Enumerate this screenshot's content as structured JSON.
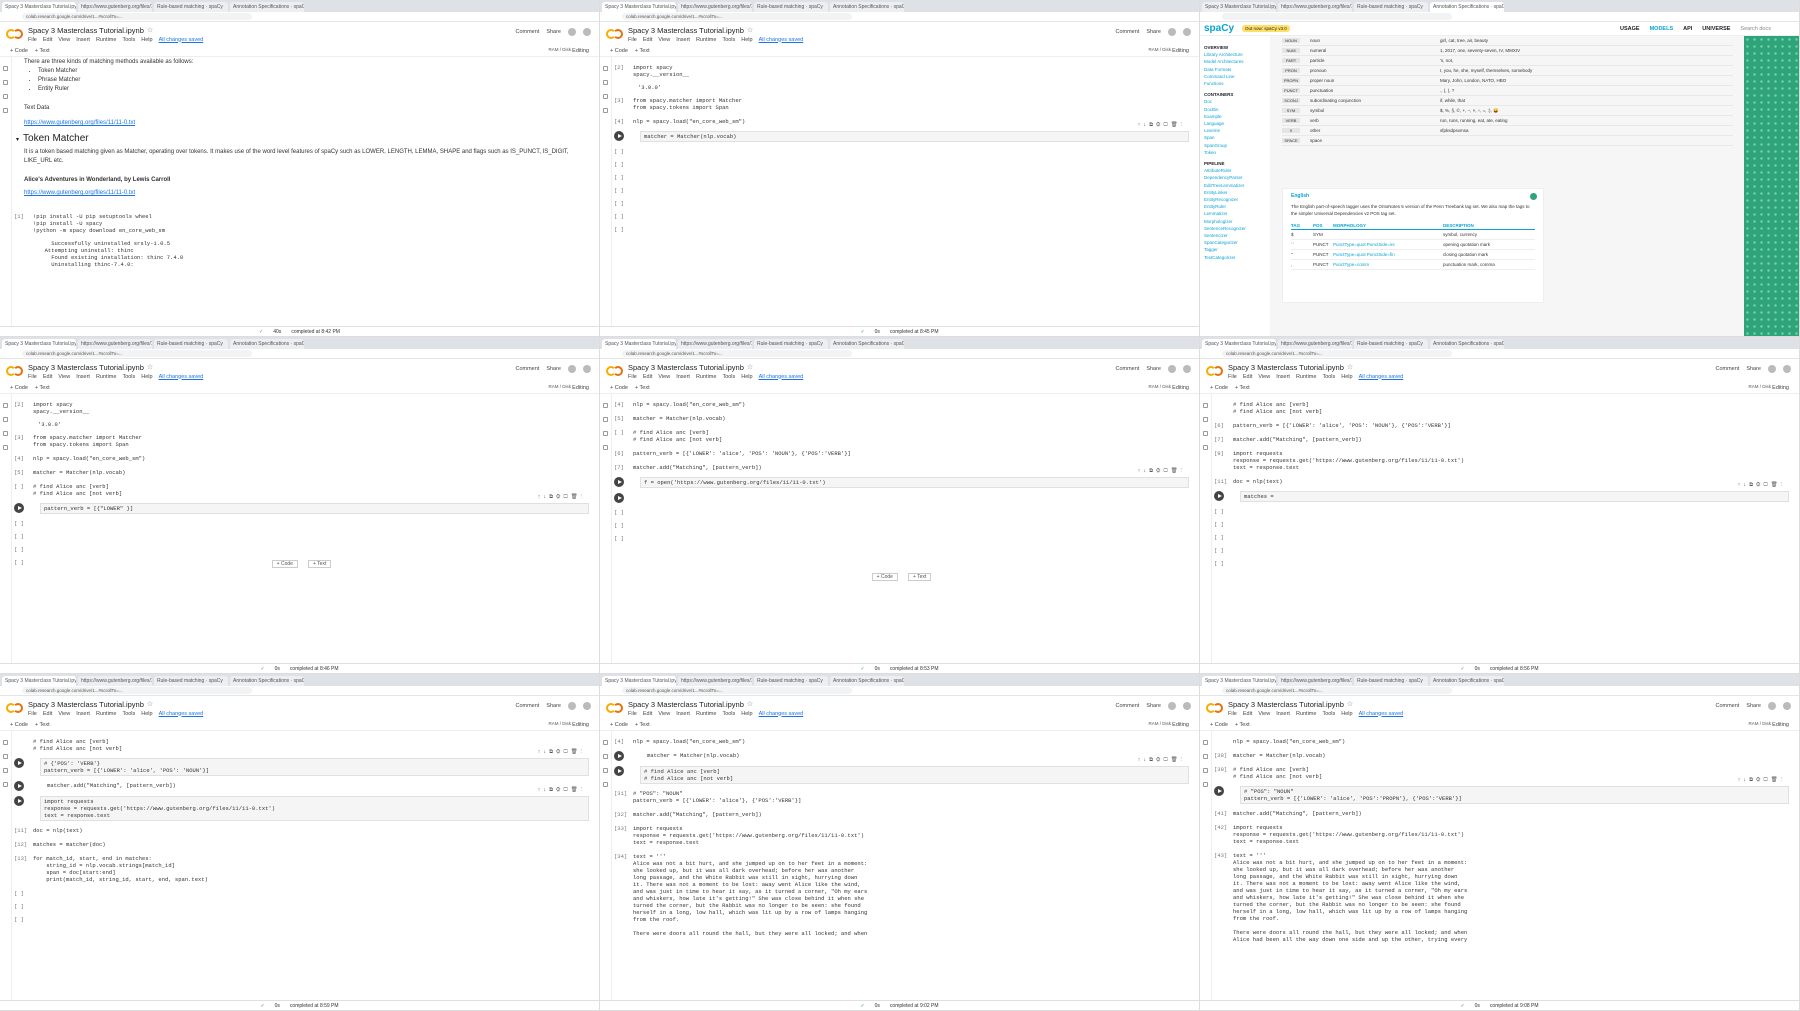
{
  "common": {
    "tabs": [
      "Spacy 3 Masterclass Tutorial.ipynb",
      "https://www.gutenberg.org/files/11",
      "Rule-based matching · spaCy",
      "Annotation Specifications · spaCy"
    ],
    "url": "colab.research.google.com/drive/1...#scrollTo=...",
    "notebook_title": "Spacy 3 Masterclass Tutorial.ipynb",
    "menu": [
      "File",
      "Edit",
      "View",
      "Insert",
      "Runtime",
      "Tools",
      "Help"
    ],
    "saved": "All changes saved",
    "comment": "Comment",
    "share": "Share",
    "add_code": "+ Code",
    "add_text": "+ Text",
    "ram": "RAM",
    "disk": "Disk",
    "editing": "Editing"
  },
  "panels": [
    {
      "status": {
        "time": "40s",
        "completed": "completed at 8:42 PM"
      },
      "intro": "There are three kinds of matching methods available as follows:",
      "methods": [
        "Token Matcher",
        "Phrase Matcher",
        "Entity Ruler"
      ],
      "text_data_label": "Text Data",
      "link1": "https://www.gutenberg.org/files/11/11-0.txt",
      "heading": "Token Matcher",
      "para": "It is a token based matching given as Matcher, operating over tokens. It makes use of the word level features of spaCy such as LOWER, LENGTH, LEMMA, SHAPE and flags such as IS_PUNCT, IS_DIGIT, LIKE_URL etc.",
      "book": "Alice's Adventures in Wonderland, by Lewis Carroll",
      "link2": "https://www.gutenberg.org/files/11/11-0.txt",
      "cell_idx": "[1]",
      "cell_code": "!pip install -U pip setuptools wheel\n!pip install -U spacy\n!python -m spacy download en_core_web_sm",
      "cell_out": "    Successfully uninstalled srsly-1.0.5\n  Attempting uninstall: thinc\n    Found existing installation: thinc 7.4.0\n    Uninstalling thinc-7.4.0:"
    },
    {
      "status": {
        "time": "0s",
        "completed": "completed at 8:45 PM"
      },
      "cells": [
        {
          "idx": "[2]",
          "code": "import spacy\nspacy.__version__",
          "out": "'3.0.0'"
        },
        {
          "idx": "[3]",
          "code": "from spacy.matcher import Matcher\nfrom spacy.tokens import Span"
        },
        {
          "idx": "[4]",
          "code": "nlp = spacy.load(\"en_core_web_sm\")"
        },
        {
          "idx": "",
          "code": "matcher = Matcher(nlp.vocab)",
          "active": true
        },
        {
          "idx": "[ ]",
          "code": ""
        },
        {
          "idx": "[ ]",
          "code": ""
        },
        {
          "idx": "[ ]",
          "code": ""
        },
        {
          "idx": "[ ]",
          "code": ""
        },
        {
          "idx": "[ ]",
          "code": ""
        },
        {
          "idx": "[ ]",
          "code": ""
        },
        {
          "idx": "[ ]",
          "code": ""
        }
      ]
    },
    {
      "logo": "spaCy",
      "badge": "Out now: spaCy v3.0",
      "links": [
        "USAGE",
        "MODELS",
        "API",
        "UNIVERSE"
      ],
      "search": "Search docs",
      "side_overview": "OVERVIEW",
      "side1": [
        "Library Architecture",
        "Model Architectures",
        "Data Formats",
        "Command Line",
        "Functions"
      ],
      "side_containers": "CONTAINERS",
      "side2": [
        "Doc",
        "DocBin",
        "Example",
        "Language",
        "Lexeme",
        "Span",
        "SpanGroup",
        "Token"
      ],
      "side_pipeline": "PIPELINE",
      "side3": [
        "AttributeRuler",
        "DependencyParser",
        "EditTreeLemmatizer",
        "EntityLinker",
        "EntityRecognizer",
        "EntityRuler",
        "Lemmatizer",
        "Morphologizer",
        "SentenceRecognizer",
        "Sentencizer",
        "SpanCategorizer",
        "Tagger",
        "TextCategorizer"
      ],
      "rows": [
        {
          "tag": "NOUN",
          "desc": "noun",
          "ex": "girl, cat, tree, air, beauty"
        },
        {
          "tag": "NUM",
          "desc": "numeral",
          "ex": "1, 2017, one, seventy-seven, IV, MMXIV"
        },
        {
          "tag": "PART",
          "desc": "particle",
          "ex": "'s, not,"
        },
        {
          "tag": "PRON",
          "desc": "pronoun",
          "ex": "I, you, he, she, myself, themselves, somebody"
        },
        {
          "tag": "PROPN",
          "desc": "proper noun",
          "ex": "Mary, John, London, NATO, HBO"
        },
        {
          "tag": "PUNCT",
          "desc": "punctuation",
          "ex": "., (, ), ?"
        },
        {
          "tag": "SCONJ",
          "desc": "subordinating conjunction",
          "ex": "if, while, that"
        },
        {
          "tag": "SYM",
          "desc": "symbol",
          "ex": "$, %, §, ©, +, −, ×, ÷, =, :), 😝"
        },
        {
          "tag": "VERB",
          "desc": "verb",
          "ex": "run, runs, running, eat, ate, eating"
        },
        {
          "tag": "X",
          "desc": "other",
          "ex": "sfpksdpsxmsa"
        },
        {
          "tag": "SPACE",
          "desc": "space",
          "ex": ""
        }
      ],
      "card_lang": "English",
      "card_text": "The English part-of-speech tagger uses the OntoNotes 5 version of the Penn Treebank tag set. We also map the tags to the simpler Universal Dependencies v2 POS tag set.",
      "card_headers": [
        "TAG",
        "POS",
        "MORPHOLOGY",
        "DESCRIPTION"
      ],
      "card_rows": [
        {
          "tag": "$",
          "pos": "SYM",
          "morph": "",
          "desc": "symbol, currency"
        },
        {
          "tag": "``",
          "pos": "PUNCT",
          "morph": "PunctType=quot PunctSide=ini",
          "desc": "opening quotation mark"
        },
        {
          "tag": "''",
          "pos": "PUNCT",
          "morph": "PunctType=quot PunctSide=fin",
          "desc": "closing quotation mark"
        },
        {
          "tag": ",",
          "pos": "PUNCT",
          "morph": "PunctType=comm",
          "desc": "punctuation mark, comma"
        }
      ]
    },
    {
      "status": {
        "time": "0s",
        "completed": "completed at 8:46 PM"
      },
      "cells": [
        {
          "idx": "[2]",
          "code": "import spacy\nspacy.__version__",
          "out": "'3.0.0'"
        },
        {
          "idx": "[3]",
          "code": "from spacy.matcher import Matcher\nfrom spacy.tokens import Span"
        },
        {
          "idx": "[4]",
          "code": "nlp = spacy.load(\"en_core_web_sm\")"
        },
        {
          "idx": "[5]",
          "code": "matcher = Matcher(nlp.vocab)"
        },
        {
          "idx": "[ ]",
          "code": "# find Alice anc [verb]\n# find Alice anc [not verb]"
        },
        {
          "idx": "",
          "code": "pattern_verb = [{\"LOWER\" }]",
          "active": true
        },
        {
          "idx": "[ ]",
          "code": ""
        },
        {
          "idx": "[ ]",
          "code": ""
        },
        {
          "idx": "[ ]",
          "code": ""
        },
        {
          "idx": "[ ]",
          "code": ""
        }
      ]
    },
    {
      "status": {
        "time": "0s",
        "completed": "completed at 8:53 PM"
      },
      "cells": [
        {
          "idx": "[4]",
          "code": "nlp = spacy.load(\"en_core_web_sm\")"
        },
        {
          "idx": "[5]",
          "code": "matcher = Matcher(nlp.vocab)"
        },
        {
          "idx": "[ ]",
          "code": "# find Alice anc [verb]\n# find Alice anc [not verb]"
        },
        {
          "idx": "[6]",
          "code": "pattern_verb = [{'LOWER': 'alice', 'POS': 'NOUN'}, {'POS':'VERB'}]"
        },
        {
          "idx": "[7]",
          "code": "matcher.add(\"Matching\", [pattern_verb])"
        },
        {
          "idx": "",
          "code": "f = open('https://www.gutenberg.org/files/11/11-0.txt')",
          "active": true
        },
        {
          "idx": "",
          "code": "",
          "run": true
        },
        {
          "idx": "[ ]",
          "code": ""
        },
        {
          "idx": "[ ]",
          "code": ""
        },
        {
          "idx": "[ ]",
          "code": ""
        }
      ]
    },
    {
      "status": {
        "time": "0s",
        "completed": "completed at 8:56 PM"
      },
      "cells": [
        {
          "idx": "",
          "code": "# find Alice anc [verb]\n# find Alice anc [not verb]"
        },
        {
          "idx": "[6]",
          "code": "pattern_verb = [{'LOWER': 'alice', 'POS': 'NOUN'}, {'POS':'VERB'}]"
        },
        {
          "idx": "[7]",
          "code": "matcher.add(\"Matching\", [pattern_verb])"
        },
        {
          "idx": "[9]",
          "code": "import requests\nresponse = requests.get('https://www.gutenberg.org/files/11/11-0.txt')\ntext = response.text"
        },
        {
          "idx": "[11]",
          "code": "doc = nlp(text)"
        },
        {
          "idx": "",
          "code": "matches =",
          "active": true
        },
        {
          "idx": "[ ]",
          "code": ""
        },
        {
          "idx": "[ ]",
          "code": ""
        },
        {
          "idx": "[ ]",
          "code": ""
        },
        {
          "idx": "[ ]",
          "code": ""
        },
        {
          "idx": "[ ]",
          "code": ""
        }
      ]
    },
    {
      "status": {
        "time": "0s",
        "completed": "completed at 8:59 PM"
      },
      "cells": [
        {
          "idx": "",
          "code": "# find Alice anc [verb]\n# find Alice anc [not verb]"
        },
        {
          "idx": "",
          "code": "# {'POS': 'VERB'}\npattern_verb = [{'LOWER': 'alice', 'POS': 'NOUN'}]",
          "active": true
        },
        {
          "idx": "",
          "code": "matcher.add(\"Matching\", [pattern_verb])",
          "run": true
        },
        {
          "idx": "",
          "code": "import requests\nresponse = requests.get('https://www.gutenberg.org/files/11/11-0.txt')\ntext = response.text",
          "active": true
        },
        {
          "idx": "[11]",
          "code": "doc = nlp(text)"
        },
        {
          "idx": "[12]",
          "code": "matches = matcher(doc)"
        },
        {
          "idx": "[13]",
          "code": "for match_id, start, end in matches:\n    string_id = nlp.vocab.strings[match_id]\n    span = doc[start:end]\n    print(match_id, string_id, start, end, span.text)"
        },
        {
          "idx": "[ ]",
          "code": ""
        },
        {
          "idx": "[ ]",
          "code": ""
        },
        {
          "idx": "[ ]",
          "code": ""
        }
      ]
    },
    {
      "status": {
        "time": "0s",
        "completed": "completed at 9:02 PM"
      },
      "cells": [
        {
          "idx": "[4]",
          "code": "nlp = spacy.load(\"en_core_web_sm\")"
        },
        {
          "idx": "",
          "code": "matcher = Matcher(nlp.vocab)",
          "run": true
        },
        {
          "idx": "",
          "code": "# find Alice anc [verb]\n# find Alice anc [not verb]",
          "active": true
        },
        {
          "idx": "[31]",
          "code": "# \"POS\": \"NOUN\"\npattern_verb = [{'LOWER': 'alice'}, {'POS':'VERB'}]"
        },
        {
          "idx": "[32]",
          "code": "matcher.add(\"Matching\", [pattern_verb])"
        },
        {
          "idx": "[33]",
          "code": "import requests\nresponse = requests.get('https://www.gutenberg.org/files/11/11-0.txt')\ntext = response.text"
        },
        {
          "idx": "[34]",
          "code": "text = '''\nAlice was not a bit hurt, and she jumped up on to her feet in a moment:\nshe looked up, but it was all dark overhead; before her was another\nlong passage, and the White Rabbit was still in sight, hurrying down\nit. There was not a moment to be lost: away went Alice like the wind,\nand was just in time to hear it say, as it turned a corner, \"Oh my ears\nand whiskers, how late it's getting!\" She was close behind it when she\nturned the corner, but the Rabbit was no longer to be seen: she found\nherself in a long, low hall, which was lit up by a row of lamps hanging\nfrom the roof.\n\nThere were doors all round the hall, but they were all locked; and when"
        }
      ]
    },
    {
      "status": {
        "time": "0s",
        "completed": "completed at 9:08 PM"
      },
      "cells": [
        {
          "idx": "",
          "code": "nlp = spacy.load(\"en_core_web_sm\")"
        },
        {
          "idx": "[38]",
          "code": "matcher = Matcher(nlp.vocab)"
        },
        {
          "idx": "[39]",
          "code": "# find Alice anc [verb]\n# find Alice anc [not verb]"
        },
        {
          "idx": "",
          "code": "# \"POS\": \"NOUN\"\npattern_verb = [{'LOWER': 'alice', 'POS':'PROPN'}, {'POS':'VERB'}]",
          "active": true
        },
        {
          "idx": "[41]",
          "code": "matcher.add(\"Matching\", [pattern_verb])"
        },
        {
          "idx": "[42]",
          "code": "import requests\nresponse = requests.get('https://www.gutenberg.org/files/11/11-0.txt')\ntext = response.text"
        },
        {
          "idx": "[43]",
          "code": "text = '''\nAlice was not a bit hurt, and she jumped up on to her feet in a moment:\nshe looked up, but it was all dark overhead; before her was another\nlong passage, and the White Rabbit was still in sight, hurrying down\nit. There was not a moment to be lost: away went Alice like the wind,\nand was just in time to hear it say, as it turned a corner, \"Oh my ears\nand whiskers, how late it's getting!\" She was close behind it when she\nturned the corner, but the Rabbit was no longer to be seen: she found\nherself in a long, low hall, which was lit up by a row of lamps hanging\nfrom the roof.\n\nThere were doors all round the hall, but they were all locked; and when\nAlice had been all the way down one side and up the other, trying every"
        }
      ]
    }
  ]
}
